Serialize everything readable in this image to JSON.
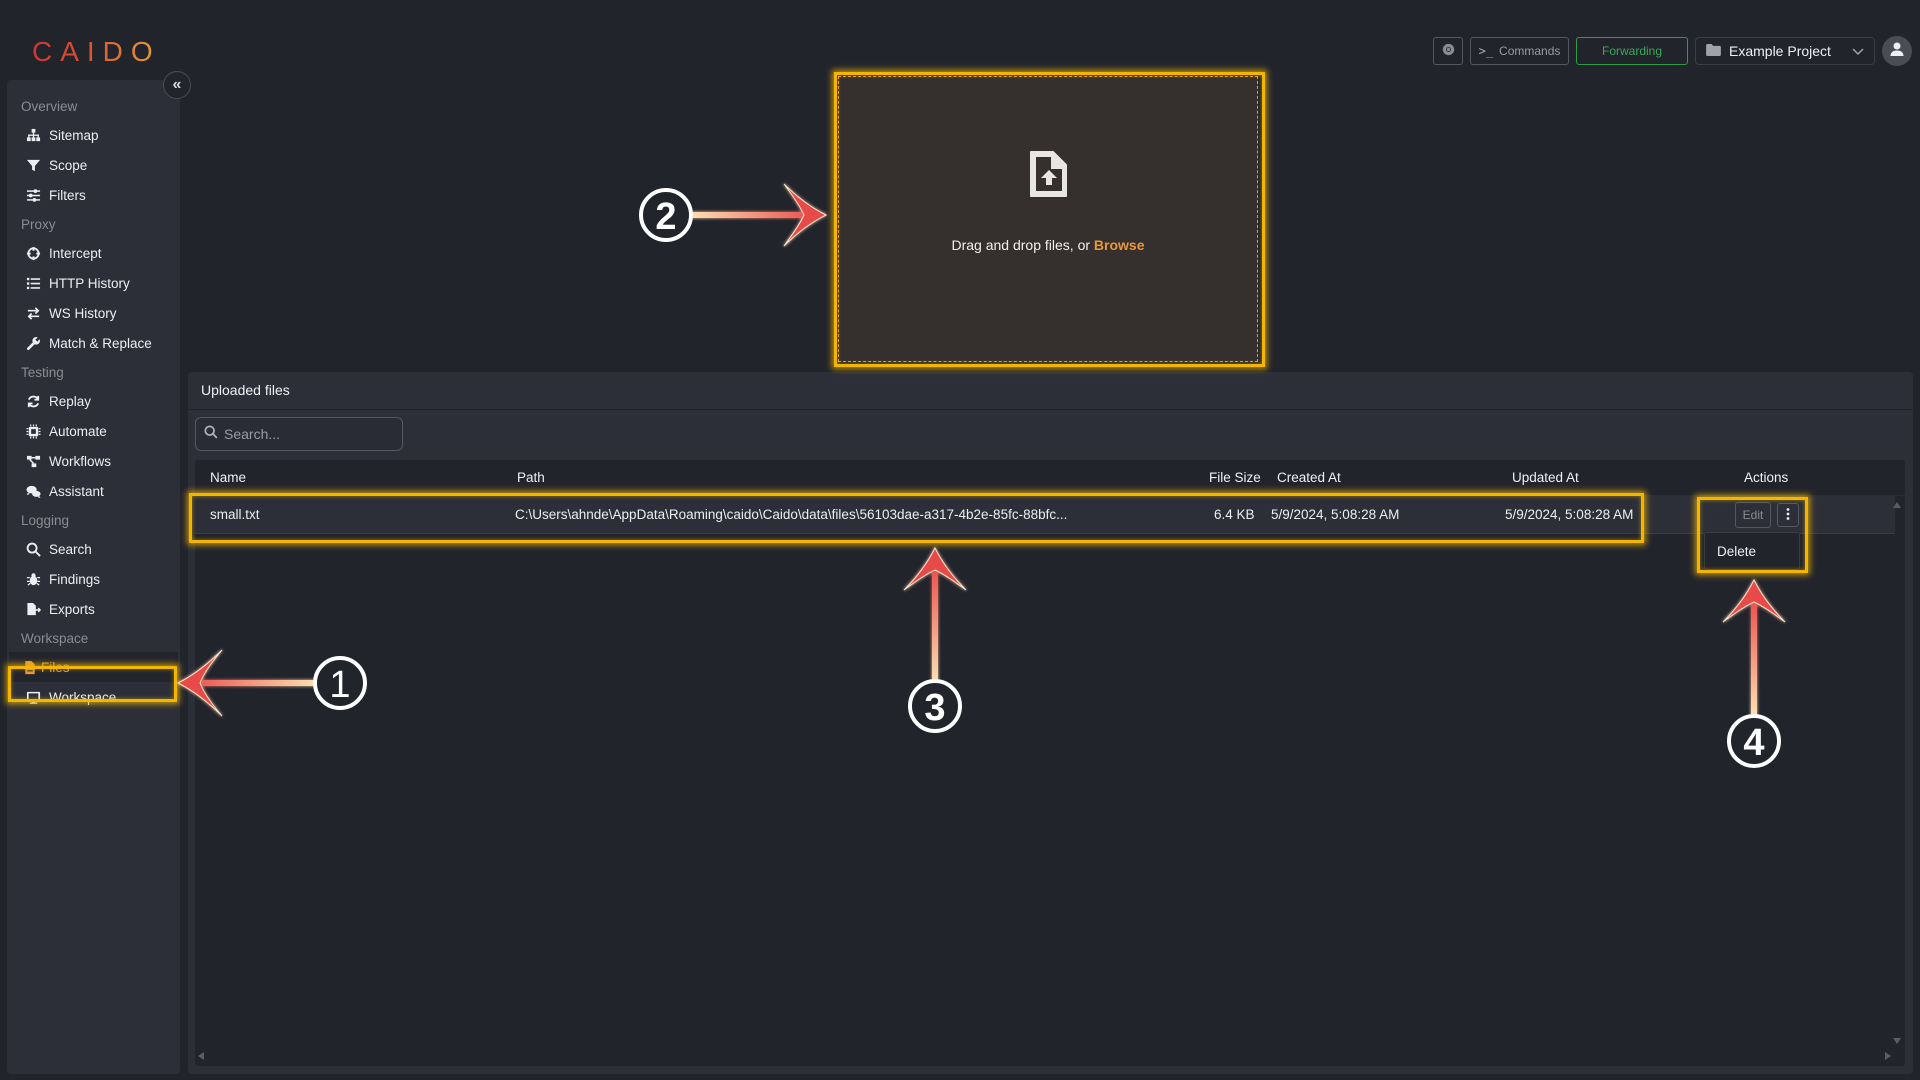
{
  "app": {
    "logo": "CAIDO",
    "accent_color": "#e8973c"
  },
  "sidebar": {
    "collapse_icon": "double-chevron-left",
    "sections": [
      {
        "label": "Overview",
        "items": [
          {
            "label": "Sitemap",
            "icon": "sitemap-icon"
          },
          {
            "label": "Scope",
            "icon": "filter-icon"
          },
          {
            "label": "Filters",
            "icon": "sliders-icon"
          }
        ]
      },
      {
        "label": "Proxy",
        "items": [
          {
            "label": "Intercept",
            "icon": "crosshair-icon"
          },
          {
            "label": "HTTP History",
            "icon": "list-icon"
          },
          {
            "label": "WS History",
            "icon": "arrows-exchange-icon"
          },
          {
            "label": "Match & Replace",
            "icon": "wrench-icon"
          }
        ]
      },
      {
        "label": "Testing",
        "items": [
          {
            "label": "Replay",
            "icon": "refresh-icon"
          },
          {
            "label": "Automate",
            "icon": "chip-icon"
          },
          {
            "label": "Workflows",
            "icon": "workflow-icon"
          },
          {
            "label": "Assistant",
            "icon": "chat-icon"
          }
        ]
      },
      {
        "label": "Logging",
        "items": [
          {
            "label": "Search",
            "icon": "search-icon"
          },
          {
            "label": "Findings",
            "icon": "bug-icon"
          },
          {
            "label": "Exports",
            "icon": "file-export-icon"
          }
        ]
      },
      {
        "label": "Workspace",
        "items": [
          {
            "label": "Files",
            "icon": "file-icon",
            "active": true
          },
          {
            "label": "Workspace",
            "icon": "monitor-icon"
          }
        ]
      }
    ]
  },
  "topbar": {
    "browser_icon": "chrome-icon",
    "commands_label": "Commands",
    "forwarding_label": "Forwarding",
    "forwarding_color": "#3aa85a",
    "project_label": "Example Project",
    "avatar_icon": "user-icon"
  },
  "dropzone": {
    "text": "Drag and drop files, or ",
    "browse_label": "Browse"
  },
  "files_panel": {
    "title": "Uploaded files",
    "search_placeholder": "Search...",
    "columns": [
      "Name",
      "Path",
      "File Size",
      "Created At",
      "Updated At",
      "Actions"
    ],
    "rows": [
      {
        "name": "small.txt",
        "path": "C:\\Users\\ahnde\\AppData\\Roaming\\caido\\Caido\\data\\files\\56103dae-a317-4b2e-85fc-88bfc...",
        "size": "6.4 KB",
        "created_at": "5/9/2024, 5:08:28 AM",
        "updated_at": "5/9/2024, 5:08:28 AM"
      }
    ],
    "edit_label": "Edit",
    "menu_items": [
      "Delete"
    ]
  },
  "annotations": {
    "markers": [
      "1",
      "2",
      "3",
      "4"
    ],
    "highlight_color": "#f2b600"
  }
}
